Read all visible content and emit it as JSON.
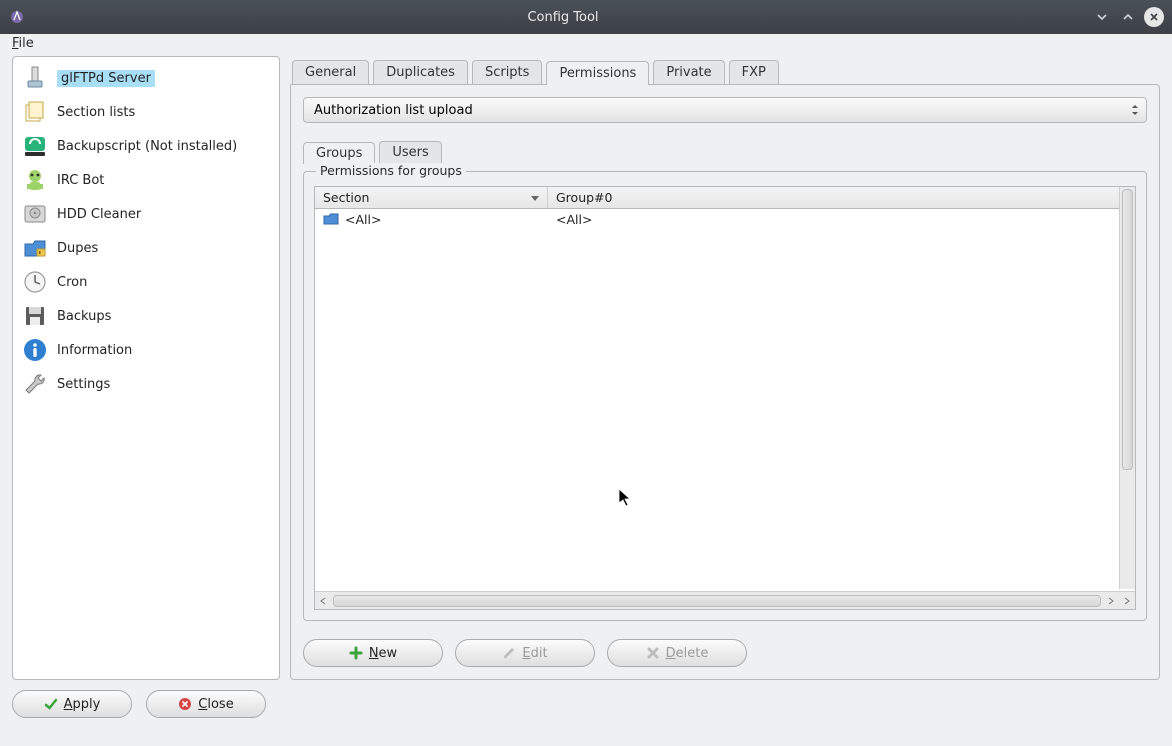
{
  "window": {
    "title": "Config Tool"
  },
  "menubar": {
    "file": "File"
  },
  "sidebar": {
    "items": [
      {
        "label": "glFTPd Server",
        "icon": "server-icon"
      },
      {
        "label": "Section lists",
        "icon": "sections-icon"
      },
      {
        "label": "Backupscript (Not installed)",
        "icon": "backupscript-icon"
      },
      {
        "label": "IRC Bot",
        "icon": "bot-icon"
      },
      {
        "label": "HDD Cleaner",
        "icon": "hdd-icon"
      },
      {
        "label": "Dupes",
        "icon": "dupes-icon"
      },
      {
        "label": "Cron",
        "icon": "clock-icon"
      },
      {
        "label": "Backups",
        "icon": "save-icon"
      },
      {
        "label": "Information",
        "icon": "info-icon"
      },
      {
        "label": "Settings",
        "icon": "wrench-icon"
      }
    ],
    "selected_index": 0
  },
  "tabs": {
    "items": [
      "General",
      "Duplicates",
      "Scripts",
      "Permissions",
      "Private",
      "FXP"
    ],
    "active_index": 3
  },
  "permissions": {
    "combo": {
      "value": "Authorization list upload"
    },
    "subtabs": {
      "items": [
        "Groups",
        "Users"
      ],
      "active_index": 0
    },
    "groupbox_title": "Permissions for groups",
    "table": {
      "columns": [
        "Section",
        "Group#0"
      ],
      "rows": [
        {
          "section": "<All>",
          "group0": "<All>"
        }
      ]
    },
    "buttons": {
      "new": "New",
      "edit": "Edit",
      "delete": "Delete"
    }
  },
  "footer": {
    "apply": "Apply",
    "close": "Close"
  }
}
